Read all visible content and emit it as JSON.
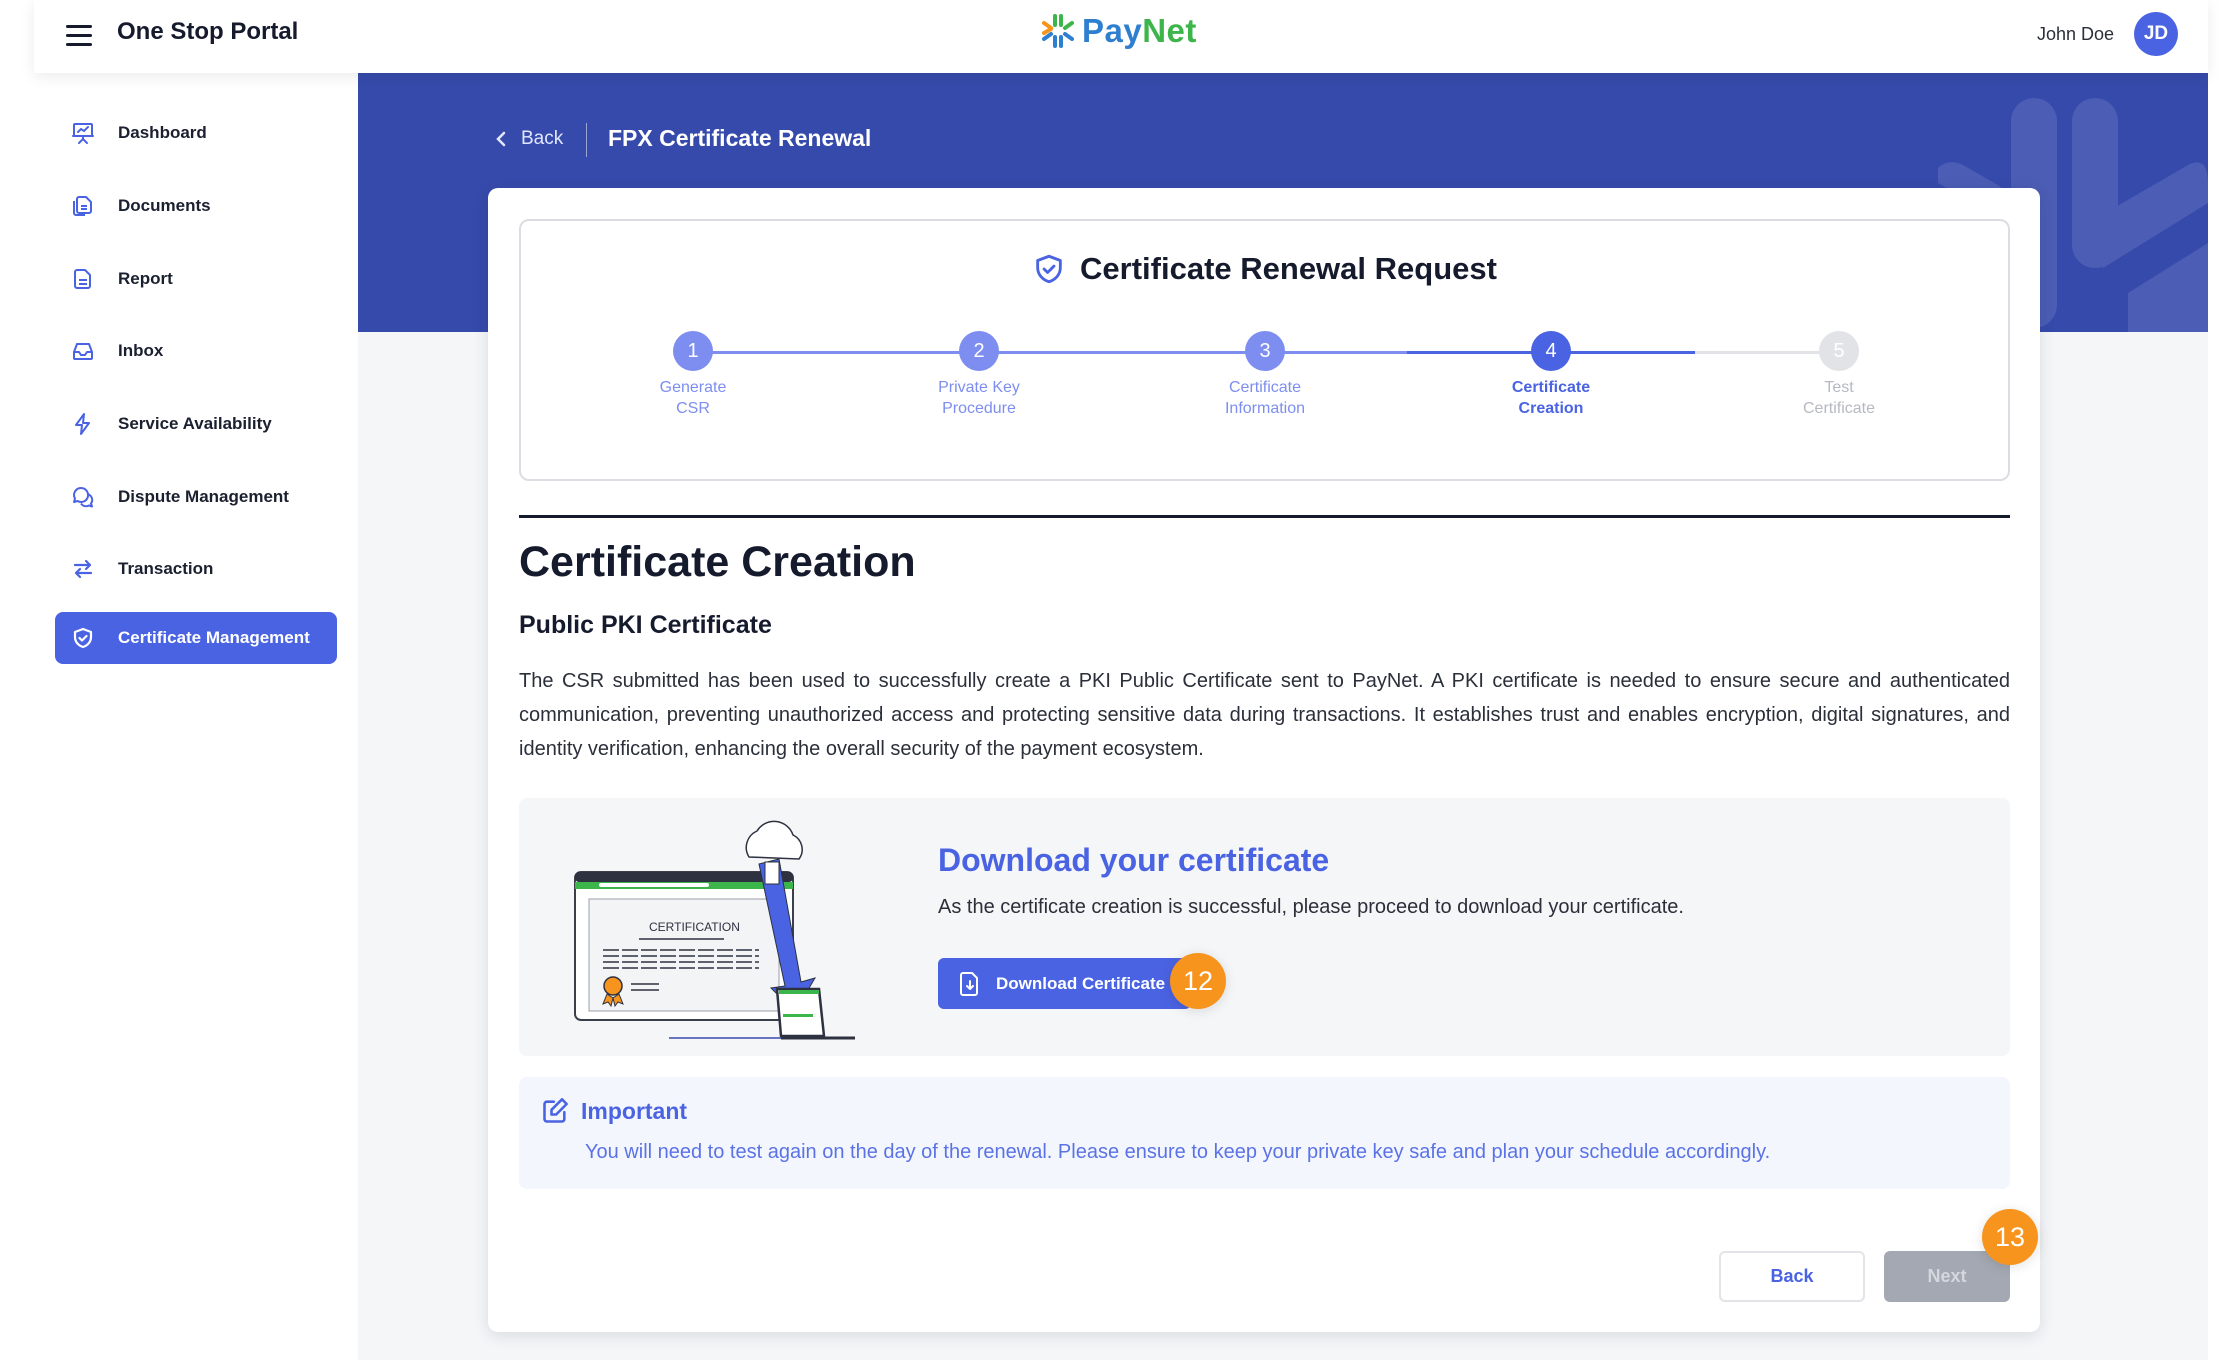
{
  "header": {
    "menu_icon": "hamburger-menu-icon",
    "app_title": "One Stop Portal",
    "logo": {
      "text_pay": "Pay",
      "text_net": "Net",
      "icon": "paynet-snowflake-logo-icon"
    },
    "user": {
      "name": "John Doe",
      "initials": "JD"
    }
  },
  "colors": {
    "primary": "#4a63e2",
    "banner": "#364aab",
    "step_done": "#7d8ef0",
    "step_todo": "#e2e3e7",
    "badge": "#f7941d",
    "next_disabled": "#a3a8b2",
    "logo_blue": "#2f7fd0",
    "logo_green": "#3cb54a",
    "logo_orange": "#f7941d"
  },
  "sidebar": {
    "items": [
      {
        "label": "Dashboard",
        "icon": "presentation-chart-icon",
        "active": false
      },
      {
        "label": "Documents",
        "icon": "documents-icon",
        "active": false
      },
      {
        "label": "Report",
        "icon": "report-file-icon",
        "active": false
      },
      {
        "label": "Inbox",
        "icon": "inbox-tray-icon",
        "active": false
      },
      {
        "label": "Service Availability",
        "icon": "lightning-bolt-icon",
        "active": false
      },
      {
        "label": "Dispute Management",
        "icon": "chat-bubbles-icon",
        "active": false
      },
      {
        "label": "Transaction",
        "icon": "swap-arrows-icon",
        "active": false
      },
      {
        "label": "Certificate Management",
        "icon": "shield-check-icon",
        "active": true
      }
    ]
  },
  "breadcrumb": {
    "back_label": "Back",
    "page_title": "FPX Certificate Renewal"
  },
  "stepper": {
    "title": "Certificate Renewal Request",
    "title_icon": "shield-check-icon",
    "current_step": 4,
    "steps": [
      {
        "number": "1",
        "line1": "Generate",
        "line2": "CSR",
        "state": "done"
      },
      {
        "number": "2",
        "line1": "Private Key",
        "line2": "Procedure",
        "state": "done"
      },
      {
        "number": "3",
        "line1": "Certificate",
        "line2": "Information",
        "state": "done"
      },
      {
        "number": "4",
        "line1": "Certificate",
        "line2": "Creation",
        "state": "active"
      },
      {
        "number": "5",
        "line1": "Test",
        "line2": "Certificate",
        "state": "todo"
      }
    ]
  },
  "content": {
    "heading": "Certificate Creation",
    "subheading": "Public PKI Certificate",
    "paragraph": "The CSR submitted has been used to successfully create a PKI Public Certificate sent to PayNet. A PKI certificate is needed to ensure secure and authenticated communication, preventing unauthorized access and protecting sensitive data during transactions. It establishes trust and enables encryption, digital signatures, and identity verification, enhancing the overall security of the payment ecosystem."
  },
  "download": {
    "illustration_label": "CERTIFICATION",
    "title": "Download your certificate",
    "description": "As the certificate creation is successful, please proceed to download your certificate.",
    "button_label": "Download Certificate",
    "button_icon": "file-download-icon",
    "badge": "12"
  },
  "important": {
    "icon": "edit-note-icon",
    "title": "Important",
    "text": "You will need to test again on the day of the renewal. Please ensure to keep your private key safe and plan your schedule accordingly."
  },
  "footer": {
    "back_label": "Back",
    "next_label": "Next",
    "next_disabled": true,
    "next_badge": "13"
  }
}
